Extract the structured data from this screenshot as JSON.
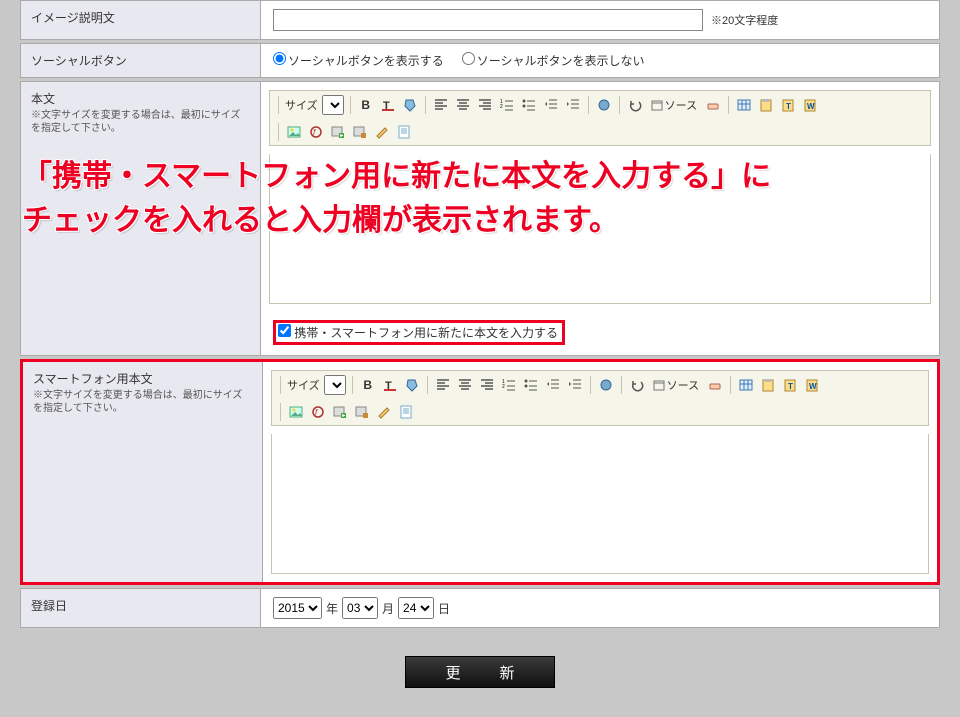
{
  "rows": {
    "imageDesc": {
      "label": "イメージ説明文",
      "hint": "※20文字程度"
    },
    "social": {
      "label": "ソーシャルボタン",
      "opt_show": "ソーシャルボタンを表示する",
      "opt_hide": "ソーシャルボタンを表示しない"
    },
    "body": {
      "label": "本文",
      "note": "※文字サイズを変更する場合は、最初にサイズを指定して下さい。",
      "checkbox": "携帯・スマートフォン用に新たに本文を入力する"
    },
    "spBody": {
      "label": "スマートフォン用本文",
      "note": "※文字サイズを変更する場合は、最初にサイズを指定して下さい。"
    },
    "date": {
      "label": "登録日",
      "year": "2015",
      "y_suffix": "年",
      "month": "03",
      "m_suffix": "月",
      "day": "24",
      "d_suffix": "日"
    }
  },
  "editor": {
    "size_label": "サイズ",
    "source_label": "ソース"
  },
  "overlay": {
    "line1": "「携帯・スマートフォン用に新たに本文を入力する」に",
    "line2": "チェックを入れると入力欄が表示されます。"
  },
  "buttons": {
    "update": "更　新"
  }
}
